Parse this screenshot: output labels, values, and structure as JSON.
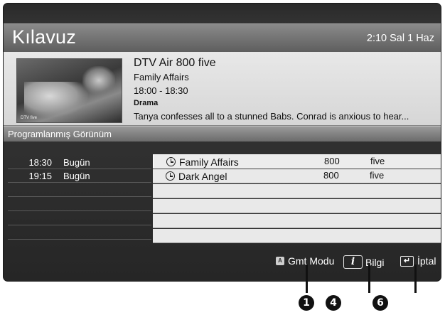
{
  "header": {
    "title": "Kılavuz",
    "clock": "2:10 Sal 1 Haz"
  },
  "info": {
    "channel": "DTV Air 800 five",
    "program": "Family Affairs",
    "time": "18:00 - 18:30",
    "genre": "Drama",
    "description": "Tanya confesses all to a stunned Babs. Conrad is anxious to hear..."
  },
  "section": {
    "title": "Programlanmış Görünüm"
  },
  "scheduled": [
    {
      "time": "18:30",
      "day": "Bugün",
      "program": "Family Affairs",
      "channel_number": "800",
      "channel_name": "five",
      "icon": "clock-icon"
    },
    {
      "time": "19:15",
      "day": "Bugün",
      "program": "Dark Angel",
      "channel_number": "800",
      "channel_name": "five",
      "icon": "clock-icon"
    }
  ],
  "footer": {
    "gmt_key": "A",
    "gmt_label": "Gmt Modu",
    "info_key": "i",
    "info_label": "Bilgi",
    "cancel_key": "↵",
    "cancel_label": "İptal"
  },
  "callouts": [
    "1",
    "4",
    "6"
  ],
  "colors": {
    "background": "#2b2b2b",
    "title_bar": "#6e6e6e",
    "info_panel": "#e0e0e0",
    "list_row": "#e9e9e9"
  }
}
